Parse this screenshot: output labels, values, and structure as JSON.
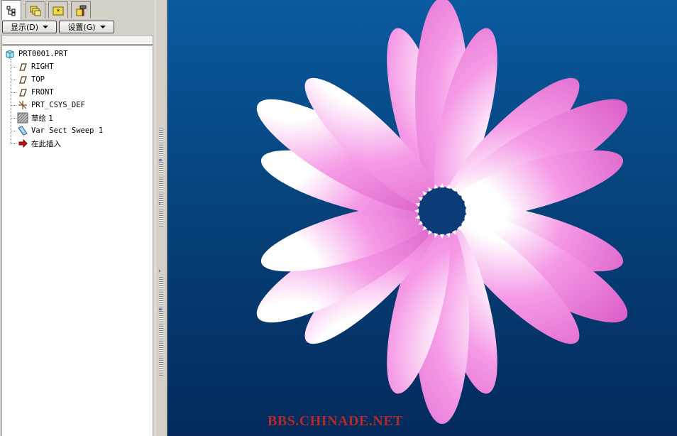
{
  "tabs": [
    {
      "name": "model-tree-tab",
      "icon": "model-tree-icon"
    },
    {
      "name": "folder-browser-tab",
      "icon": "folder-icon"
    },
    {
      "name": "favorites-tab",
      "icon": "favorites-icon"
    },
    {
      "name": "tools-tab",
      "icon": "hammer-icon"
    }
  ],
  "toolbar": {
    "show_label": "显示(D)",
    "settings_label": "设置(G)"
  },
  "tree": {
    "root": "PRT0001.PRT",
    "items": [
      {
        "label": "RIGHT",
        "icon": "datum-plane-icon"
      },
      {
        "label": "TOP",
        "icon": "datum-plane-icon"
      },
      {
        "label": "FRONT",
        "icon": "datum-plane-icon"
      },
      {
        "label": "PRT_CSYS_DEF",
        "icon": "csys-icon"
      },
      {
        "label": "草绘 1",
        "icon": "sketch-icon"
      },
      {
        "label": "Var Sect Sweep 1",
        "icon": "sweep-icon"
      },
      {
        "label": "在此插入",
        "icon": "insert-here-arrow-icon"
      }
    ]
  },
  "viewport": {
    "watermark": "BBS.CHINADE.NET",
    "background_top": "#0a5aa0",
    "background_bottom": "#042a5c",
    "petal_color": "#e878d8",
    "petal_center_color": "#ffffff"
  }
}
